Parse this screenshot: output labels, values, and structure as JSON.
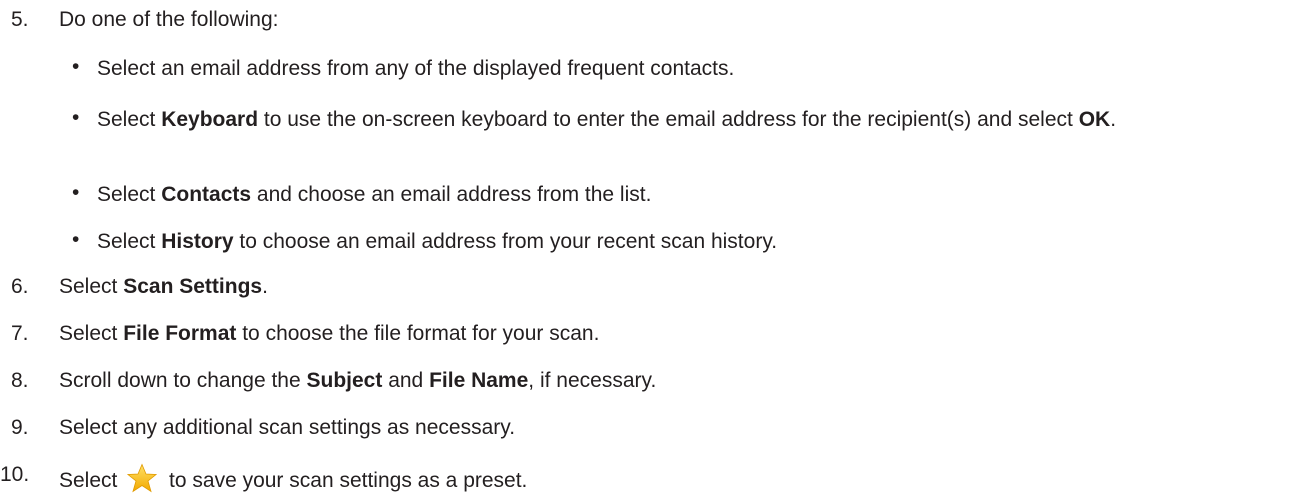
{
  "steps": [
    {
      "number": "5.",
      "text": "Do one of the following:",
      "bullets": [
        {
          "marker": "•",
          "parts": [
            "Select an email address from any of the displayed frequent contacts."
          ]
        },
        {
          "marker": "•",
          "parts": [
            "Select ",
            "Keyboard",
            " to use the on-screen keyboard to enter the email address for the recipient(s) and select ",
            "OK",
            "."
          ]
        },
        {
          "marker": "•",
          "parts": [
            "Select ",
            "Contacts",
            " and choose an email address from the list."
          ]
        },
        {
          "marker": "•",
          "parts": [
            "Select ",
            "History",
            " to choose an email address from your recent scan history."
          ]
        }
      ]
    },
    {
      "number": "6.",
      "parts": [
        "Select ",
        "Scan Settings",
        "."
      ]
    },
    {
      "number": "7.",
      "parts": [
        "Select ",
        "File Format",
        " to choose the file format for your scan."
      ]
    },
    {
      "number": "8.",
      "parts": [
        "Scroll down to change the ",
        "Subject",
        " and ",
        "File Name",
        ", if necessary."
      ]
    },
    {
      "number": "9.",
      "parts": [
        "Select any additional scan settings as necessary."
      ]
    },
    {
      "number": "10.",
      "parts": [
        "Select ",
        " to save your scan settings as a preset."
      ],
      "icon": "star-icon"
    }
  ],
  "colors": {
    "text": "#231f20",
    "star_fill": "#f7c21b",
    "star_highlight": "#ffe066"
  }
}
